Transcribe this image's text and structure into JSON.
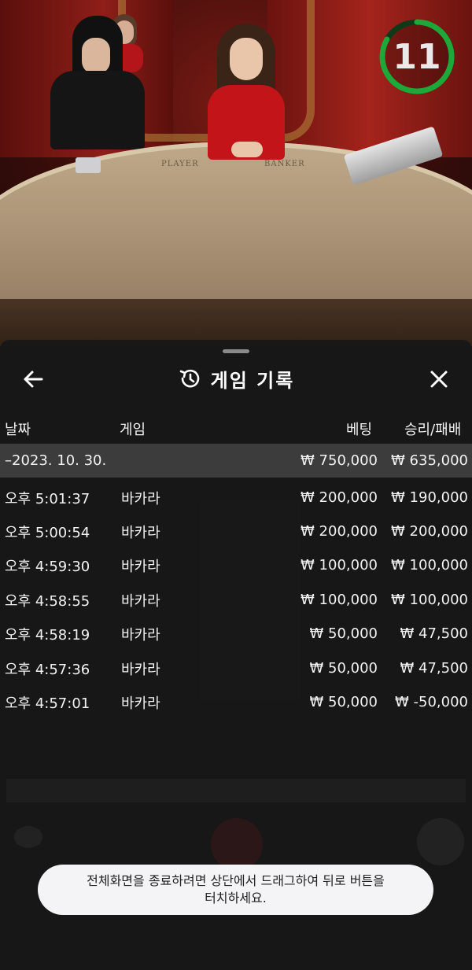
{
  "timer": {
    "value": "11",
    "color": "#1ea83a"
  },
  "table_labels": {
    "player": "PLAYER",
    "banker": "BANKER"
  },
  "header": {
    "title": "게임 기록",
    "back_icon": "arrow-left-icon",
    "history_icon": "history-icon",
    "close_icon": "close-icon"
  },
  "columns": {
    "date": "날짜",
    "game": "게임",
    "bet": "베팅",
    "result": "승리/패배"
  },
  "date_group": {
    "date": "–2023. 10. 30.",
    "bet_total": "₩ 750,000",
    "result_total": "₩ 635,000"
  },
  "rows": [
    {
      "time": "오후 5:01:37",
      "game": "바카라",
      "bet": "₩ 200,000",
      "result": "₩ 190,000"
    },
    {
      "time": "오후 5:00:54",
      "game": "바카라",
      "bet": "₩ 200,000",
      "result": "₩ 200,000"
    },
    {
      "time": "오후 4:59:30",
      "game": "바카라",
      "bet": "₩ 100,000",
      "result": "₩ 100,000"
    },
    {
      "time": "오후 4:58:55",
      "game": "바카라",
      "bet": "₩ 100,000",
      "result": "₩ 100,000"
    },
    {
      "time": "오후 4:58:19",
      "game": "바카라",
      "bet": "₩ 50,000",
      "result": "₩ 47,500"
    },
    {
      "time": "오후 4:57:36",
      "game": "바카라",
      "bet": "₩ 50,000",
      "result": "₩ 47,500"
    },
    {
      "time": "오후 4:57:01",
      "game": "바카라",
      "bet": "₩ 50,000",
      "result": "₩ -50,000"
    }
  ],
  "toast": {
    "line1": "전체화면을 종료하려면 상단에서 드래그하여 뒤로 버튼을",
    "line2": "터치하세요."
  }
}
